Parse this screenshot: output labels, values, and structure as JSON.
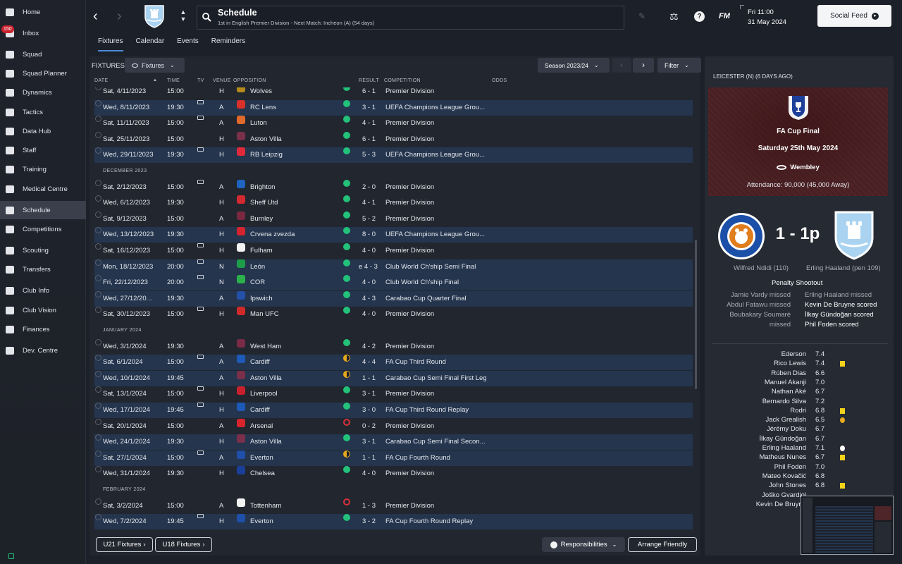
{
  "sidebar": {
    "items": [
      {
        "label": "Home",
        "icon": "home-icon"
      },
      {
        "label": "Inbox",
        "icon": "inbox-icon",
        "badge": "150"
      },
      {
        "label": "Squad",
        "icon": "shirt-icon"
      },
      {
        "label": "Squad Planner",
        "icon": "planner-icon"
      },
      {
        "label": "Dynamics",
        "icon": "handshake-icon"
      },
      {
        "label": "Tactics",
        "icon": "tactics-board-icon"
      },
      {
        "label": "Data Hub",
        "icon": "pie-chart-icon"
      },
      {
        "label": "Staff",
        "icon": "staff-icon"
      },
      {
        "label": "Training",
        "icon": "cone-icon"
      },
      {
        "label": "Medical Centre",
        "icon": "medical-kit-icon"
      },
      {
        "label": "Schedule",
        "icon": "calendar-icon"
      },
      {
        "label": "Competitions",
        "icon": "trophy-icon"
      },
      {
        "label": "Scouting",
        "icon": "magnifier-icon"
      },
      {
        "label": "Transfers",
        "icon": "transfer-arrows-icon"
      },
      {
        "label": "Club Info",
        "icon": "shield-icon"
      },
      {
        "label": "Club Vision",
        "icon": "briefcase-icon"
      },
      {
        "label": "Finances",
        "icon": "money-icon"
      },
      {
        "label": "Dev. Centre",
        "icon": "growth-icon"
      }
    ],
    "active_index": 10
  },
  "header": {
    "title": "Schedule",
    "subtitle": "1st in English Premier Division - Next Match: Incheon (A) (54 days)",
    "fm_label": "FM",
    "time": "Fri 11:00",
    "date": "31 May 2024",
    "social_feed": "Social Feed"
  },
  "tabs": [
    "Fixtures",
    "Calendar",
    "Events",
    "Reminders"
  ],
  "toolbar": {
    "section_label": "FIXTURES",
    "view_dropdown": "Fixtures",
    "season": "Season 2023/24",
    "filter": "Filter"
  },
  "columns": {
    "date": "DATE",
    "time": "TIME",
    "tv": "TV",
    "venue": "VENUE",
    "opposition": "OPPOSITION",
    "result": "RESULT",
    "competition": "COMPETITION",
    "odds": "ODDS"
  },
  "fixtures": [
    {
      "date": "Sat, 4/11/2023",
      "time": "15:00",
      "tv": false,
      "venue": "H",
      "opp": "Wolves",
      "outcome": "win",
      "result": "6 - 1",
      "comp": "Premier Division",
      "crest": "#b58a1a",
      "partial": true
    },
    {
      "date": "Wed, 8/11/2023",
      "time": "19:30",
      "tv": true,
      "venue": "A",
      "opp": "RC Lens",
      "outcome": "win",
      "result": "3 - 1",
      "comp": "UEFA Champions League Grou...",
      "crest": "#d8312a",
      "hl": true
    },
    {
      "date": "Sat, 11/11/2023",
      "time": "15:00",
      "tv": true,
      "venue": "A",
      "opp": "Luton",
      "outcome": "win",
      "result": "4 - 1",
      "comp": "Premier Division",
      "crest": "#e06a2c"
    },
    {
      "date": "Sat, 25/11/2023",
      "time": "15:00",
      "tv": false,
      "venue": "H",
      "opp": "Aston Villa",
      "outcome": "win",
      "result": "6 - 1",
      "comp": "Premier Division",
      "crest": "#7a2f4a"
    },
    {
      "date": "Wed, 29/11/2023",
      "time": "19:30",
      "tv": true,
      "venue": "H",
      "opp": "RB Leipzig",
      "outcome": "win",
      "result": "5 - 3",
      "comp": "UEFA Champions League Grou...",
      "crest": "#e02a3a",
      "hl": true
    },
    {
      "month": "DECEMBER 2023"
    },
    {
      "date": "Sat, 2/12/2023",
      "time": "15:00",
      "tv": true,
      "venue": "A",
      "opp": "Brighton",
      "outcome": "win",
      "result": "2 - 0",
      "comp": "Premier Division",
      "crest": "#1f64c0"
    },
    {
      "date": "Wed, 6/12/2023",
      "time": "19:30",
      "tv": false,
      "venue": "H",
      "opp": "Sheff Utd",
      "outcome": "win",
      "result": "4 - 1",
      "comp": "Premier Division",
      "crest": "#d22a30"
    },
    {
      "date": "Sat, 9/12/2023",
      "time": "15:00",
      "tv": false,
      "venue": "A",
      "opp": "Burnley",
      "outcome": "win",
      "result": "5 - 2",
      "comp": "Premier Division",
      "crest": "#7a2740"
    },
    {
      "date": "Wed, 13/12/2023",
      "time": "19:30",
      "tv": false,
      "venue": "H",
      "opp": "Crvena zvezda",
      "outcome": "win",
      "result": "8 - 0",
      "comp": "UEFA Champions League Grou...",
      "crest": "#d6242e",
      "hl": true
    },
    {
      "date": "Sat, 16/12/2023",
      "time": "15:00",
      "tv": true,
      "venue": "H",
      "opp": "Fulham",
      "outcome": "win",
      "result": "4 - 0",
      "comp": "Premier Division",
      "crest": "#f2f2f2"
    },
    {
      "date": "Mon, 18/12/2023",
      "time": "20:00",
      "tv": true,
      "venue": "N",
      "opp": "León",
      "outcome": "win",
      "result": "e 4 - 3",
      "comp": "Club World Ch'ship Semi Final",
      "crest": "#1e9c4a",
      "hl": true
    },
    {
      "date": "Fri, 22/12/2023",
      "time": "20:00",
      "tv": true,
      "venue": "N",
      "opp": "COR",
      "outcome": "win",
      "result": "4 - 0",
      "comp": "Club World Ch'ship Final",
      "crest": "#2bb04a",
      "hl": true
    },
    {
      "date": "Wed, 27/12/20...",
      "time": "19:30",
      "tv": false,
      "venue": "A",
      "opp": "Ipswich",
      "outcome": "win",
      "result": "4 - 3",
      "comp": "Carabao Cup Quarter Final",
      "crest": "#2550a8",
      "hl": true
    },
    {
      "date": "Sat, 30/12/2023",
      "time": "15:00",
      "tv": true,
      "venue": "H",
      "opp": "Man UFC",
      "outcome": "win",
      "result": "4 - 0",
      "comp": "Premier Division",
      "crest": "#d02a2a"
    },
    {
      "month": "JANUARY 2024"
    },
    {
      "date": "Wed, 3/1/2024",
      "time": "19:30",
      "tv": false,
      "venue": "A",
      "opp": "West Ham",
      "outcome": "win",
      "result": "4 - 2",
      "comp": "Premier Division",
      "crest": "#7a2b48"
    },
    {
      "date": "Sat, 6/1/2024",
      "time": "15:00",
      "tv": true,
      "venue": "A",
      "opp": "Cardiff",
      "outcome": "draw",
      "result": "4 - 4",
      "comp": "FA Cup Third Round",
      "crest": "#1d5ab8",
      "hl": true
    },
    {
      "date": "Wed, 10/1/2024",
      "time": "19:45",
      "tv": false,
      "venue": "A",
      "opp": "Aston Villa",
      "outcome": "draw",
      "result": "1 - 1",
      "comp": "Carabao Cup Semi Final First Leg",
      "crest": "#7a2f4a",
      "hl": true
    },
    {
      "date": "Sat, 13/1/2024",
      "time": "15:00",
      "tv": true,
      "venue": "H",
      "opp": "Liverpool",
      "outcome": "win",
      "result": "3 - 1",
      "comp": "Premier Division",
      "crest": "#c8202c"
    },
    {
      "date": "Wed, 17/1/2024",
      "time": "19:45",
      "tv": true,
      "venue": "H",
      "opp": "Cardiff",
      "outcome": "win",
      "result": "3 - 0",
      "comp": "FA Cup Third Round Replay",
      "crest": "#1d5ab8",
      "hl": true
    },
    {
      "date": "Sat, 20/1/2024",
      "time": "15:00",
      "tv": false,
      "venue": "A",
      "opp": "Arsenal",
      "outcome": "loss",
      "result": "0 - 2",
      "comp": "Premier Division",
      "crest": "#d8242c"
    },
    {
      "date": "Wed, 24/1/2024",
      "time": "19:30",
      "tv": false,
      "venue": "H",
      "opp": "Aston Villa",
      "outcome": "win",
      "result": "3 - 1",
      "comp": "Carabao Cup Semi Final Secon...",
      "crest": "#7a2f4a",
      "hl": true
    },
    {
      "date": "Sat, 27/1/2024",
      "time": "15:00",
      "tv": true,
      "venue": "A",
      "opp": "Everton",
      "outcome": "draw",
      "result": "1 - 1",
      "comp": "FA Cup Fourth Round",
      "crest": "#1f4fa8",
      "hl": true
    },
    {
      "date": "Wed, 31/1/2024",
      "time": "19:30",
      "tv": false,
      "venue": "H",
      "opp": "Chelsea",
      "outcome": "win",
      "result": "4 - 0",
      "comp": "Premier Division",
      "crest": "#1a3f9a"
    },
    {
      "month": "FEBRUARY 2024"
    },
    {
      "date": "Sat, 3/2/2024",
      "time": "15:00",
      "tv": false,
      "venue": "A",
      "opp": "Tottenham",
      "outcome": "loss",
      "result": "1 - 3",
      "comp": "Premier Division",
      "crest": "#f2f2f2"
    },
    {
      "date": "Wed, 7/2/2024",
      "time": "19:45",
      "tv": true,
      "venue": "H",
      "opp": "Everton",
      "outcome": "win",
      "result": "3 - 2",
      "comp": "FA Cup Fourth Round Replay",
      "crest": "#1f4fa8",
      "hl": true
    }
  ],
  "bottom_buttons": {
    "u21": "U21 Fixtures",
    "u18": "U18 Fixtures",
    "responsibilities": "Responsibilities",
    "arrange": "Arrange Friendly"
  },
  "match": {
    "header": "LEICESTER (N) (6 DAYS AGO)",
    "competition": "FA Cup Final",
    "date": "Saturday 25th May 2024",
    "venue": "Wembley",
    "attendance": "Attendance: 90,000 (45,000 Away)",
    "score": "1 - 1p",
    "home_scorer": "Wilfred Ndidi (110)",
    "away_scorer": "Erling Haaland (pen 109)",
    "shootout_title": "Penalty Shootout",
    "shootout_home": [
      "Jamie Vardy missed",
      "Abdul Fatawu missed",
      "Boubakary Soumaré",
      "missed"
    ],
    "shootout_away": [
      "Erling Haaland missed",
      "Kevin De Bruyne scored",
      "İlkay Gündoğan scored",
      "Phil Foden scored"
    ],
    "ratings": [
      {
        "name": "Ederson",
        "rating": "7.4",
        "event": ""
      },
      {
        "name": "Rico Lewis",
        "rating": "7.4",
        "event": "yellow"
      },
      {
        "name": "Rúben Dias",
        "rating": "6.6",
        "event": ""
      },
      {
        "name": "Manuel Akanji",
        "rating": "7.0",
        "event": ""
      },
      {
        "name": "Nathan Aké",
        "rating": "6.7",
        "event": ""
      },
      {
        "name": "Bernardo Silva",
        "rating": "7.2",
        "event": ""
      },
      {
        "name": "Rodri",
        "rating": "6.8",
        "event": "yellow"
      },
      {
        "name": "Jack Grealish",
        "rating": "6.5",
        "event": "sub"
      },
      {
        "name": "Jérémy Doku",
        "rating": "6.7",
        "event": ""
      },
      {
        "name": "İlkay Gündoğan",
        "rating": "6.7",
        "event": ""
      },
      {
        "name": "Erling Haaland",
        "rating": "7.1",
        "event": "goal"
      },
      {
        "name": "Matheus Nunes",
        "rating": "6.7",
        "event": "yellow"
      },
      {
        "name": "Phil Foden",
        "rating": "7.0",
        "event": ""
      },
      {
        "name": "Mateo Kovačić",
        "rating": "6.8",
        "event": ""
      },
      {
        "name": "John Stones",
        "rating": "6.8",
        "event": "yellow"
      },
      {
        "name": "Joško Gvardiol",
        "rating": "",
        "event": ""
      },
      {
        "name": "Kevin De Bruyne",
        "rating": "",
        "event": ""
      }
    ]
  },
  "colors": {
    "win": "#22c27a",
    "draw": "#e8a81c",
    "loss": "#d8303a",
    "accent": "#4a8cd8",
    "highlight": "#24354d"
  }
}
